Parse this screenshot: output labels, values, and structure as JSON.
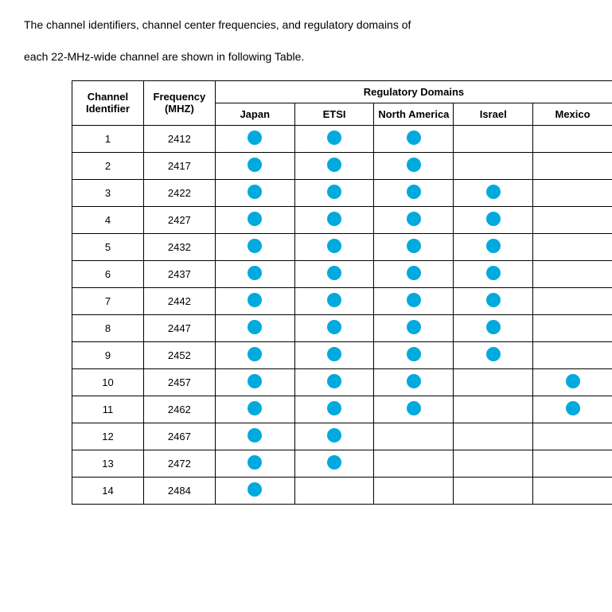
{
  "intro": {
    "line1": "The channel identifiers, channel center frequencies, and regulatory domains of",
    "line2": "each 22-MHz-wide channel are shown in following Table."
  },
  "table": {
    "header_row1": {
      "channel": "Channel Identifier",
      "frequency": "Frequency (MHZ)",
      "regulatory": "Regulatory Domains"
    },
    "header_row2": {
      "japan": "Japan",
      "etsi": "ETSI",
      "north_america": "North America",
      "israel": "Israel",
      "mexico": "Mexico"
    },
    "rows": [
      {
        "channel": "1",
        "freq": "2412",
        "japan": true,
        "etsi": true,
        "north_america": true,
        "israel": false,
        "mexico": false
      },
      {
        "channel": "2",
        "freq": "2417",
        "japan": true,
        "etsi": true,
        "north_america": true,
        "israel": false,
        "mexico": false
      },
      {
        "channel": "3",
        "freq": "2422",
        "japan": true,
        "etsi": true,
        "north_america": true,
        "israel": true,
        "mexico": false
      },
      {
        "channel": "4",
        "freq": "2427",
        "japan": true,
        "etsi": true,
        "north_america": true,
        "israel": true,
        "mexico": false
      },
      {
        "channel": "5",
        "freq": "2432",
        "japan": true,
        "etsi": true,
        "north_america": true,
        "israel": true,
        "mexico": false
      },
      {
        "channel": "6",
        "freq": "2437",
        "japan": true,
        "etsi": true,
        "north_america": true,
        "israel": true,
        "mexico": false
      },
      {
        "channel": "7",
        "freq": "2442",
        "japan": true,
        "etsi": true,
        "north_america": true,
        "israel": true,
        "mexico": false
      },
      {
        "channel": "8",
        "freq": "2447",
        "japan": true,
        "etsi": true,
        "north_america": true,
        "israel": true,
        "mexico": false
      },
      {
        "channel": "9",
        "freq": "2452",
        "japan": true,
        "etsi": true,
        "north_america": true,
        "israel": true,
        "mexico": false
      },
      {
        "channel": "10",
        "freq": "2457",
        "japan": true,
        "etsi": true,
        "north_america": true,
        "israel": false,
        "mexico": true
      },
      {
        "channel": "11",
        "freq": "2462",
        "japan": true,
        "etsi": true,
        "north_america": true,
        "israel": false,
        "mexico": true
      },
      {
        "channel": "12",
        "freq": "2467",
        "japan": true,
        "etsi": true,
        "north_america": false,
        "israel": false,
        "mexico": false
      },
      {
        "channel": "13",
        "freq": "2472",
        "japan": true,
        "etsi": true,
        "north_america": false,
        "israel": false,
        "mexico": false
      },
      {
        "channel": "14",
        "freq": "2484",
        "japan": true,
        "etsi": false,
        "north_america": false,
        "israel": false,
        "mexico": false
      }
    ]
  }
}
